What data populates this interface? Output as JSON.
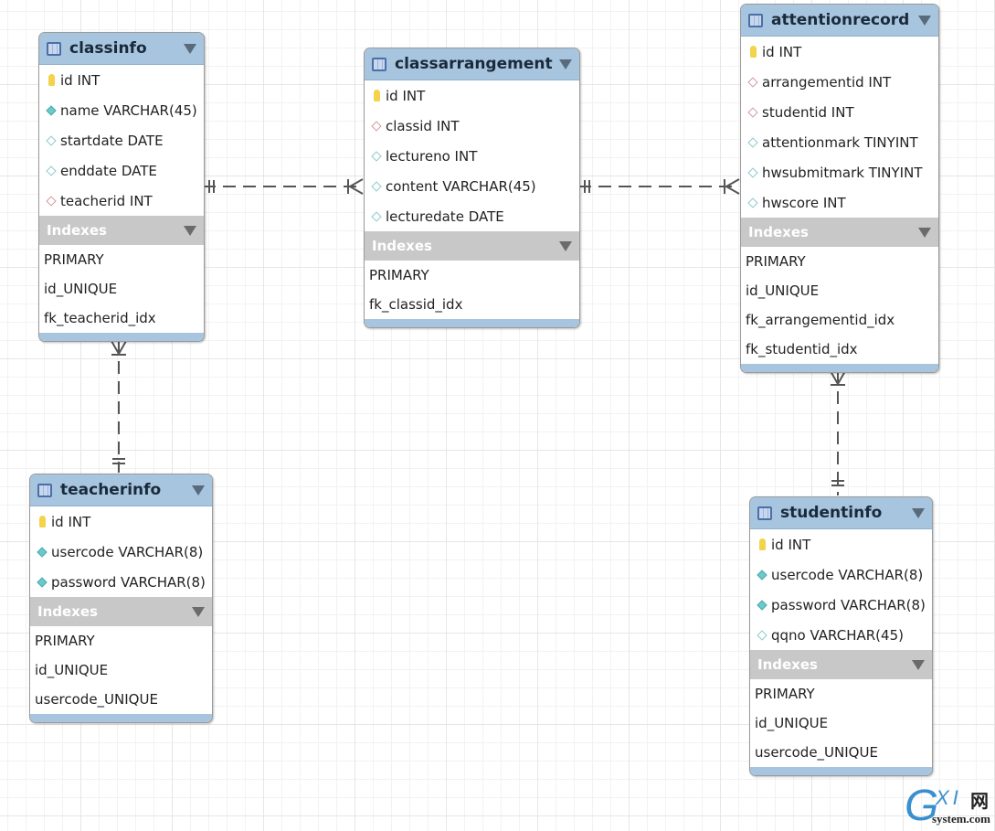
{
  "colors": {
    "header": "#a7c5de",
    "indexes_header": "#c8c8c8",
    "relationship_line": "#555555"
  },
  "tables": [
    {
      "id": "classinfo",
      "name": "classinfo",
      "columns": [
        {
          "icon": "primary-key-icon",
          "text": "id INT"
        },
        {
          "icon": "not-null-column-icon",
          "text": "name VARCHAR(45)"
        },
        {
          "icon": "nullable-column-icon",
          "text": "startdate DATE"
        },
        {
          "icon": "nullable-column-icon",
          "text": "enddate DATE"
        },
        {
          "icon": "foreign-key-icon",
          "text": "teacherid INT"
        }
      ],
      "indexes_label": "Indexes",
      "indexes": [
        "PRIMARY",
        "id_UNIQUE",
        "fk_teacherid_idx"
      ]
    },
    {
      "id": "classarrangement",
      "name": "classarrangement",
      "columns": [
        {
          "icon": "primary-key-icon",
          "text": "id INT"
        },
        {
          "icon": "foreign-key-icon",
          "text": "classid INT"
        },
        {
          "icon": "nullable-column-icon",
          "text": "lectureno INT"
        },
        {
          "icon": "nullable-column-icon",
          "text": "content VARCHAR(45)"
        },
        {
          "icon": "nullable-column-icon",
          "text": "lecturedate DATE"
        }
      ],
      "indexes_label": "Indexes",
      "indexes": [
        "PRIMARY",
        "fk_classid_idx"
      ]
    },
    {
      "id": "attentionrecord",
      "name": "attentionrecord",
      "columns": [
        {
          "icon": "primary-key-icon",
          "text": "id INT"
        },
        {
          "icon": "foreign-key-icon",
          "text": "arrangementid INT"
        },
        {
          "icon": "foreign-key-icon",
          "text": "studentid INT"
        },
        {
          "icon": "nullable-column-icon",
          "text": "attentionmark TINYINT"
        },
        {
          "icon": "nullable-column-icon",
          "text": "hwsubmitmark TINYINT"
        },
        {
          "icon": "nullable-column-icon",
          "text": "hwscore INT"
        }
      ],
      "indexes_label": "Indexes",
      "indexes": [
        "PRIMARY",
        "id_UNIQUE",
        "fk_arrangementid_idx",
        "fk_studentid_idx"
      ]
    },
    {
      "id": "teacherinfo",
      "name": "teacherinfo",
      "columns": [
        {
          "icon": "primary-key-icon",
          "text": "id INT"
        },
        {
          "icon": "not-null-column-icon",
          "text": "usercode VARCHAR(8)"
        },
        {
          "icon": "not-null-column-icon",
          "text": "password VARCHAR(8)"
        }
      ],
      "indexes_label": "Indexes",
      "indexes": [
        "PRIMARY",
        "id_UNIQUE",
        "usercode_UNIQUE"
      ]
    },
    {
      "id": "studentinfo",
      "name": "studentinfo",
      "columns": [
        {
          "icon": "primary-key-icon",
          "text": "id INT"
        },
        {
          "icon": "not-null-column-icon",
          "text": "usercode VARCHAR(8)"
        },
        {
          "icon": "not-null-column-icon",
          "text": "password VARCHAR(8)"
        },
        {
          "icon": "nullable-column-icon",
          "text": "qqno VARCHAR(45)"
        }
      ],
      "indexes_label": "Indexes",
      "indexes": [
        "PRIMARY",
        "id_UNIQUE",
        "usercode_UNIQUE"
      ]
    }
  ],
  "relationships": [
    {
      "from": "classinfo",
      "to": "classarrangement",
      "one_side": "classinfo",
      "many_side": "classarrangement"
    },
    {
      "from": "classarrangement",
      "to": "attentionrecord",
      "one_side": "classarrangement",
      "many_side": "attentionrecord"
    },
    {
      "from": "teacherinfo",
      "to": "classinfo",
      "one_side": "teacherinfo",
      "many_side": "classinfo"
    },
    {
      "from": "studentinfo",
      "to": "attentionrecord",
      "one_side": "studentinfo",
      "many_side": "attentionrecord"
    }
  ],
  "watermark": {
    "logo_text": "GXI网",
    "domain": "system.com"
  }
}
